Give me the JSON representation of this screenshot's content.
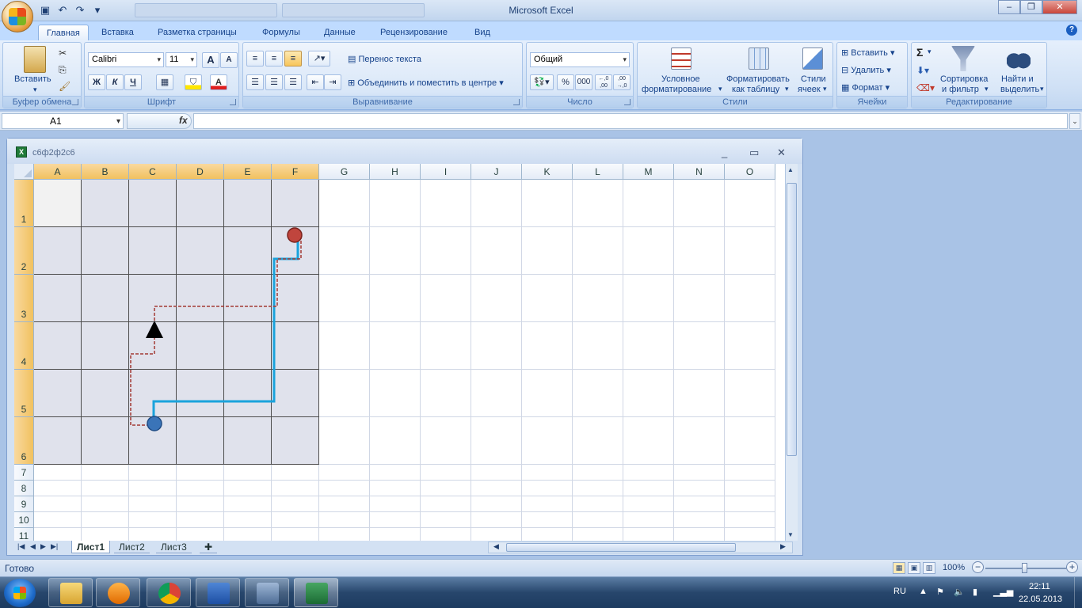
{
  "app": {
    "title": "Microsoft Excel"
  },
  "tabs": [
    "Главная",
    "Вставка",
    "Разметка страницы",
    "Формулы",
    "Данные",
    "Рецензирование",
    "Вид"
  ],
  "ribbon": {
    "clipboard": {
      "label": "Буфер обмена",
      "paste": "Вставить"
    },
    "font": {
      "label": "Шрифт",
      "name": "Calibri",
      "size": "11",
      "bold": "Ж",
      "italic": "К",
      "underline": "Ч",
      "grow": "A",
      "shrink": "A",
      "fontcolor": "A"
    },
    "align": {
      "label": "Выравнивание",
      "wrap": "Перенос текста",
      "merge": "Объединить и поместить в центре"
    },
    "number": {
      "label": "Число",
      "format": "Общий",
      "percent": "%",
      "thousands": "000",
      "inc": "←,0 ,00",
      "dec": ",00 →,0"
    },
    "styles": {
      "label": "Стили",
      "cond1": "Условное",
      "cond2": "форматирование",
      "table1": "Форматировать",
      "table2": "как таблицу",
      "cell1": "Стили",
      "cell2": "ячеек"
    },
    "cells": {
      "label": "Ячейки",
      "insert": "Вставить",
      "delete": "Удалить",
      "format": "Формат"
    },
    "editing": {
      "label": "Редактирование",
      "sum": "Σ",
      "sort1": "Сортировка",
      "sort2": "и фильтр",
      "find1": "Найти и",
      "find2": "выделить"
    }
  },
  "formula_bar": {
    "namebox": "A1",
    "fx": "fx",
    "value": ""
  },
  "workbook": {
    "name": "с6ф2ф2с6"
  },
  "columns": [
    "A",
    "B",
    "C",
    "D",
    "E",
    "F",
    "G",
    "H",
    "I",
    "J",
    "K",
    "L",
    "M",
    "N",
    "O"
  ],
  "rows": [
    "1",
    "2",
    "3",
    "4",
    "5",
    "6",
    "7",
    "8",
    "9",
    "10",
    "11"
  ],
  "sheets": [
    "Лист1",
    "Лист2",
    "Лист3"
  ],
  "status": {
    "ready": "Готово",
    "zoom": "100%"
  },
  "tray": {
    "lang": "RU",
    "time": "22:11",
    "date": "22.05.2013"
  },
  "colors": {
    "accent": "#15428b",
    "path_blue": "#1aa3dc",
    "path_red": "#a33a35",
    "start_dot": "#3a74b8",
    "end_dot": "#c0453d"
  }
}
